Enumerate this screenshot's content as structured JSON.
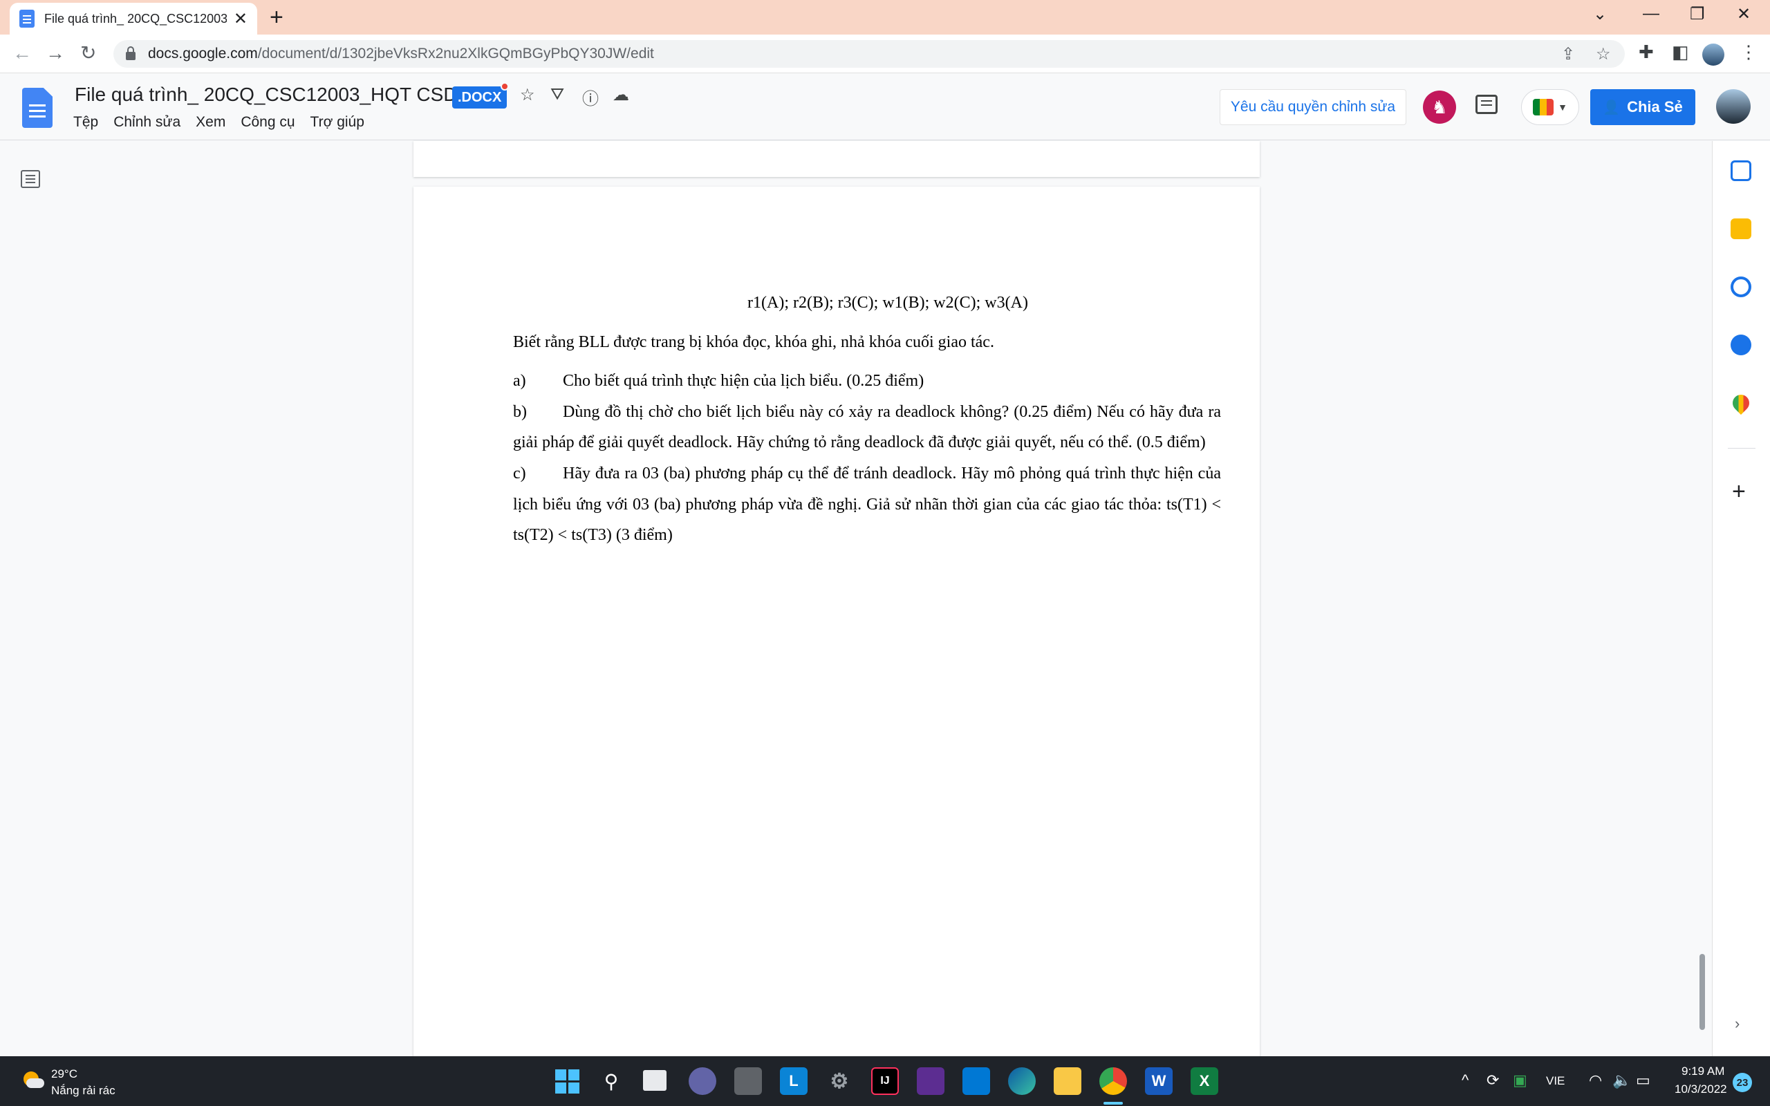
{
  "browser": {
    "tab_title": "File quá trình_ 20CQ_CSC12003_HQT CSDL",
    "url_host": "docs.google.com",
    "url_path": "/document/d/1302jbeVksRx2nu2XlkGQmBGyPbQY30JW/edit"
  },
  "docs": {
    "title": "File quá trình_ 20CQ_CSC12003_HQT CSDL",
    "badge": ".DOCX",
    "menu": [
      "Tệp",
      "Chỉnh sửa",
      "Xem",
      "Công cụ",
      "Trợ giúp"
    ],
    "request_edit_label": "Yêu cầu quyền chỉnh sửa",
    "share_label": "Chia Sẻ"
  },
  "document": {
    "schedule": "r1(A); r2(B); r3(C); w1(B); w2(C); w3(A)",
    "intro": "Biết rằng BLL được trang bị khóa đọc, khóa ghi, nhả khóa cuối giao tác.",
    "items": [
      {
        "label": "a)",
        "text": "Cho biết quá trình thực hiện của lịch biểu. (0.25 điểm)"
      },
      {
        "label": "b)",
        "text": "Dùng đồ thị chờ cho biết lịch biểu này có xảy ra deadlock không? (0.25 điểm) Nếu có hãy đưa ra giải pháp để giải quyết deadlock. Hãy chứng tỏ rằng deadlock đã được giải quyết, nếu có thể. (0.5 điểm)"
      },
      {
        "label": "c)",
        "text": "Hãy đưa ra 03 (ba)  phương pháp cụ thể để tránh deadlock. Hãy mô phỏng quá trình thực hiện của lịch biểu ứng với 03 (ba) phương pháp vừa đề nghị. Giả sử nhãn thời gian của các giao tác thỏa: ts(T1) < ts(T2) < ts(T3) (3 điểm)"
      }
    ]
  },
  "taskbar": {
    "temperature": "29°C",
    "weather": "Nắng rải rác",
    "language": "VIE",
    "time": "9:19 AM",
    "date": "10/3/2022",
    "notifications": "23"
  }
}
